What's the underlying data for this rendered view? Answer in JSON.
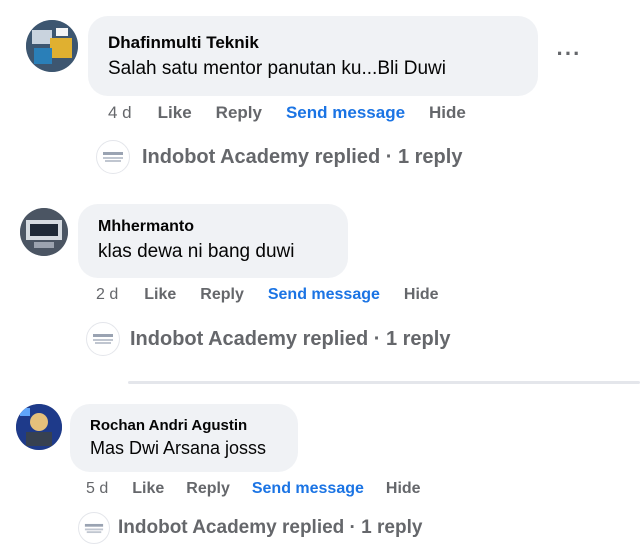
{
  "colors": {
    "bubble": "#f0f2f5",
    "secondary_text": "#65676b",
    "link_blue": "#1b74e4"
  },
  "comments": [
    {
      "author": "Dhafinmulti Teknik",
      "text": "Salah satu mentor panutan ku...Bli Duwi",
      "time": "4 d",
      "like": "Like",
      "reply": "Reply",
      "send_message": "Send message",
      "hide": "Hide",
      "replied": "Indobot Academy replied · 1 reply",
      "more_icon": "more-options-icon"
    },
    {
      "author": "Mhhermanto",
      "text": "klas dewa ni bang duwi",
      "time": "2 d",
      "like": "Like",
      "reply": "Reply",
      "send_message": "Send message",
      "hide": "Hide",
      "replied": "Indobot Academy replied · 1 reply"
    },
    {
      "author": "Rochan Andri Agustin",
      "text": "Mas Dwi Arsana josss",
      "time": "5 d",
      "like": "Like",
      "reply": "Reply",
      "send_message": "Send message",
      "hide": "Hide",
      "replied": "Indobot Academy replied · 1 reply"
    }
  ]
}
